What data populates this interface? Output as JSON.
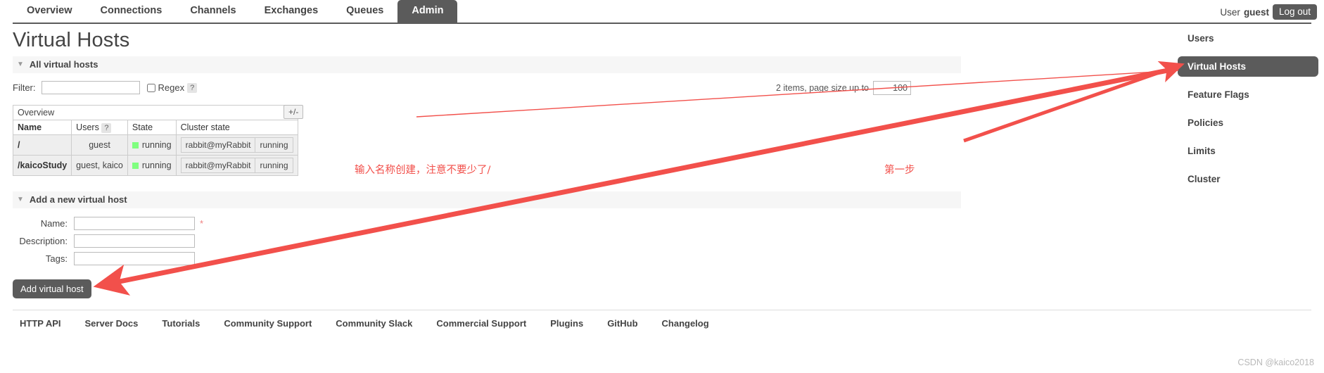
{
  "topnav": {
    "tabs": [
      {
        "label": "Overview",
        "active": false
      },
      {
        "label": "Connections",
        "active": false
      },
      {
        "label": "Channels",
        "active": false
      },
      {
        "label": "Exchanges",
        "active": false
      },
      {
        "label": "Queues",
        "active": false
      },
      {
        "label": "Admin",
        "active": true
      }
    ],
    "user_prefix": "User",
    "user_name": "guest",
    "logout_label": "Log out"
  },
  "page": {
    "title": "Virtual Hosts"
  },
  "all_hosts_section": {
    "heading": "All virtual hosts",
    "triangle": "triangle-down-icon",
    "filter_label": "Filter:",
    "filter_value": "",
    "filter_placeholder": "",
    "regex_label": "Regex",
    "help_mark": "?",
    "paging_text": "2 items, page size up to",
    "page_size": "100",
    "plus_minus_label": "+/-",
    "overview_label": "Overview"
  },
  "table": {
    "columns": [
      "Name",
      "Users",
      "State",
      "Cluster state"
    ],
    "users_help": "?",
    "rows": [
      {
        "name": "/",
        "users": "guest",
        "state": "running",
        "cluster_node": "rabbit@myRabbit",
        "cluster_state": "running"
      },
      {
        "name": "/kaicoStudy",
        "users": "guest, kaico",
        "state": "running",
        "cluster_node": "rabbit@myRabbit",
        "cluster_state": "running"
      }
    ]
  },
  "add_form": {
    "heading": "Add a new virtual host",
    "triangle": "triangle-down-icon",
    "name_label": "Name:",
    "name_value": "",
    "required_mark": "*",
    "description_label": "Description:",
    "description_value": "",
    "tags_label": "Tags:",
    "tags_value": "",
    "submit_label": "Add virtual host"
  },
  "footer": {
    "links": [
      "HTTP API",
      "Server Docs",
      "Tutorials",
      "Community Support",
      "Community Slack",
      "Commercial Support",
      "Plugins",
      "GitHub",
      "Changelog"
    ]
  },
  "sidebar": {
    "items": [
      {
        "label": "Users",
        "active": false
      },
      {
        "label": "Virtual Hosts",
        "active": true
      },
      {
        "label": "Feature Flags",
        "active": false
      },
      {
        "label": "Policies",
        "active": false
      },
      {
        "label": "Limits",
        "active": false
      },
      {
        "label": "Cluster",
        "active": false
      }
    ]
  },
  "annotations": {
    "note_create": "输入名称创建，注意不要少了/",
    "note_step_one": "第一步",
    "arrow_color": "#f2504b",
    "watermark": "CSDN @kaico2018"
  }
}
